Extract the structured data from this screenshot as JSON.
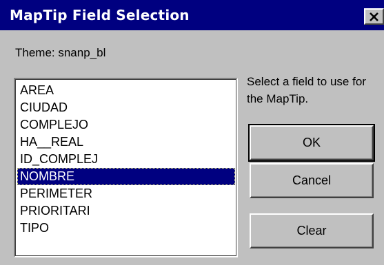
{
  "window": {
    "title": "MapTip Field Selection",
    "close_glyph": "close-icon"
  },
  "theme": {
    "label": "Theme: snanp_bl"
  },
  "fields": {
    "items": [
      "AREA",
      "CIUDAD",
      "COMPLEJO",
      "HA__REAL",
      "ID_COMPLEJ",
      "NOMBRE",
      "PERIMETER",
      "PRIORITARI",
      "TIPO"
    ],
    "selected": "NOMBRE"
  },
  "hint": {
    "text": "Select a field to use for the MapTip."
  },
  "buttons": {
    "ok_label": "OK",
    "cancel_label": "Cancel",
    "clear_label": "Clear"
  },
  "colors": {
    "titlebar": "#000080",
    "face": "#c0c0c0",
    "selection": "#000080"
  }
}
